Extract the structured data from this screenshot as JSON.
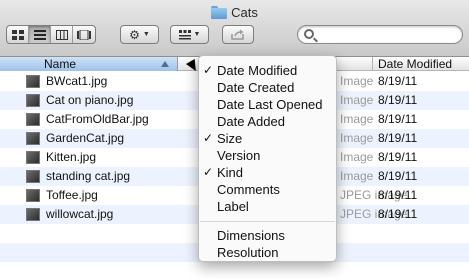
{
  "window": {
    "title": "Cats"
  },
  "toolbar": {
    "view_buttons": [
      "icon-view-icon",
      "list-view-icon",
      "column-view-icon",
      "coverflow-view-icon"
    ],
    "action_icon": "gear-icon",
    "arrange_icon": "arrange-icon",
    "share_icon": "share-icon",
    "search_placeholder": ""
  },
  "columns": {
    "name": "Name",
    "date_modified": "Date Modified"
  },
  "files": [
    {
      "name": "BWcat1.jpg",
      "kind": "Image",
      "modified": "8/19/11"
    },
    {
      "name": "Cat on piano.jpg",
      "kind": "Image",
      "modified": "8/19/11"
    },
    {
      "name": "CatFromOldBar.jpg",
      "kind": "Image",
      "modified": "8/19/11"
    },
    {
      "name": "GardenCat.jpg",
      "kind": "Image",
      "modified": "8/19/11"
    },
    {
      "name": "Kitten.jpg",
      "kind": "Image",
      "modified": "8/19/11"
    },
    {
      "name": "standing cat.jpg",
      "kind": "Image",
      "modified": "8/19/11"
    },
    {
      "name": "Toffee.jpg",
      "kind": "JPEG image",
      "modified": "8/19/11"
    },
    {
      "name": "willowcat.jpg",
      "kind": "JPEG image",
      "modified": "8/19/11"
    }
  ],
  "context_menu": {
    "items": [
      {
        "label": "Date Modified",
        "check": "✓"
      },
      {
        "label": "Date Created",
        "check": ""
      },
      {
        "label": "Date Last Opened",
        "check": ""
      },
      {
        "label": "Date Added",
        "check": ""
      },
      {
        "label": "Size",
        "check": "✓"
      },
      {
        "label": "Version",
        "check": ""
      },
      {
        "label": "Kind",
        "check": "✓"
      },
      {
        "label": "Comments",
        "check": ""
      },
      {
        "label": "Label",
        "check": ""
      },
      {
        "label": "Dimensions",
        "check": ""
      },
      {
        "label": "Resolution",
        "check": ""
      }
    ]
  },
  "colors": {
    "header_selected": "#9ec3ea",
    "row_alt": "#edf3fe"
  }
}
